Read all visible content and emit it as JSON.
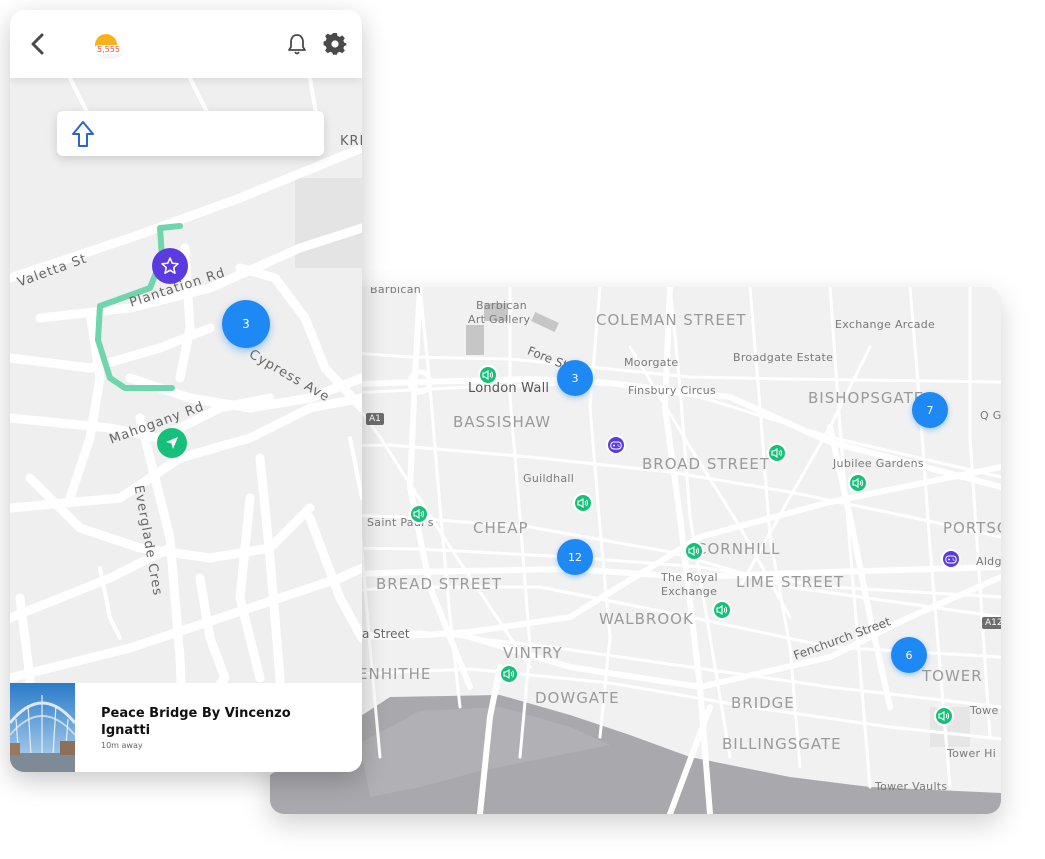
{
  "phone": {
    "score": "5,555",
    "icons": {
      "back": "chevron-left-icon",
      "weather": "sun-cloud-icon",
      "notifications": "bell-icon",
      "settings": "gear-icon",
      "direction": "arrow-up-icon",
      "destination": "star-icon",
      "navigation": "navigation-arrow-icon",
      "locate": "location-arrow-icon"
    },
    "streets": {
      "valetta": "Valetta St",
      "plantation": "Plantation Rd",
      "cypress": "Cypress Ave",
      "mahogany": "Mahogany Rd",
      "everglade": "Everglade Cres",
      "kri": "KRI"
    },
    "cluster_count": "3",
    "route_color": "#6fd5ad",
    "bottom_card": {
      "title": "Peace Bridge By Vincenzo Ignatti",
      "distance": "10m away"
    }
  },
  "map": {
    "areas": {
      "coleman_street": "COLEMAN STREET",
      "bassishaw": "BASSISHAW",
      "broad_street": "BROAD STREET",
      "bishopsgate": "BISHOPSGATE",
      "cheap": "CHEAP",
      "cornhill": "CORNHILL",
      "lime_street": "LIME STREET",
      "bread_street": "BREAD STREET",
      "walbrook": "WALBROOK",
      "vintry": "VINTRY",
      "dowgate": "DOWGATE",
      "bridge": "BRIDGE",
      "billingsgate": "BILLINGSGATE",
      "tower": "TOWER",
      "portsoken": "PORTSO",
      "queenhithe": "ENHITHE"
    },
    "places": {
      "barbican": "Barbican",
      "barbican_art_gallery_1": "Barbican",
      "barbican_art_gallery_2": "Art Gallery",
      "moorgate": "Moorgate",
      "broadgate_estate": "Broadgate Estate",
      "exchange_arcade": "Exchange Arcade",
      "finsbury_circus": "Finsbury Circus",
      "guildhall": "Guildhall",
      "jubilee_gardens": "Jubilee Gardens",
      "st_pauls": "Saint Paul's",
      "royal_exchange_1": "The Royal",
      "royal_exchange_2": "Exchange",
      "aldgate": "Aldg",
      "q_g": "Q G",
      "tower_place": "Towe",
      "tower_hill": "Tower Hi",
      "tower_vaults": "Tower Vaults"
    },
    "streets": {
      "fore_street": "Fore Street",
      "london_wall": "London Wall",
      "fenchurch_street": "Fenchurch Street",
      "a_street": "a Street"
    },
    "shields": {
      "a1": "A1",
      "a12": "A12"
    },
    "clusters": {
      "c1": "3",
      "c2": "7",
      "c3": "12",
      "c4": "6"
    },
    "icons": {
      "sound": "speaker-icon",
      "game": "gamepad-icon"
    }
  }
}
